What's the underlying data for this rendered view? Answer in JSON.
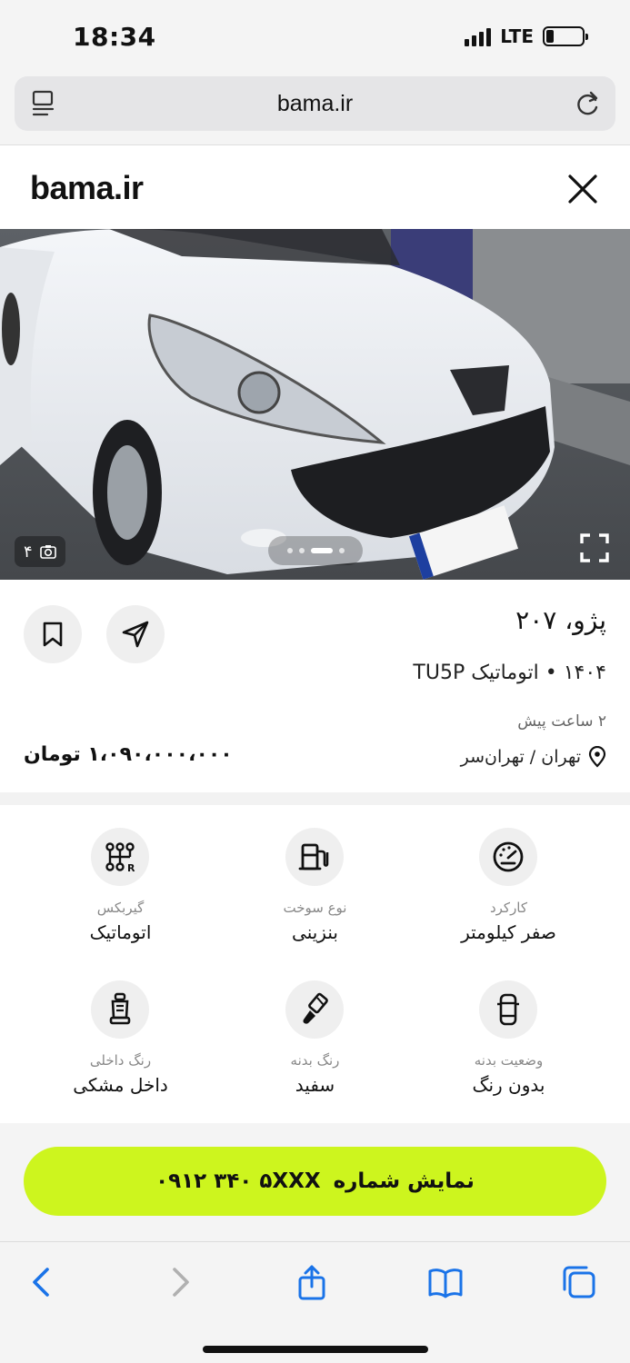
{
  "status_bar": {
    "time": "18:34",
    "network": "LTE",
    "battery_level": 0.2
  },
  "browser": {
    "url": "bama.ir"
  },
  "site": {
    "logo": "bama.ir"
  },
  "gallery": {
    "photo_count": "۴",
    "total_dots": 4,
    "active_dot": 2
  },
  "listing": {
    "title": "پژو، ۲۰۷",
    "subtitle": "۱۴۰۴ • اتوماتیک TU5P",
    "time_ago": "۲ ساعت پیش",
    "location": "تهران / تهران‌سر",
    "price": "۱،۰۹۰،۰۰۰،۰۰۰ تومان"
  },
  "specs": [
    {
      "label": "کارکرد",
      "value": "صفر کیلومتر",
      "icon": "speedometer-icon"
    },
    {
      "label": "نوع سوخت",
      "value": "بنزینی",
      "icon": "fuel-pump-icon"
    },
    {
      "label": "گیربکس",
      "value": "اتوماتیک",
      "icon": "gearbox-icon"
    },
    {
      "label": "وضعیت بدنه",
      "value": "بدون رنگ",
      "icon": "car-body-icon"
    },
    {
      "label": "رنگ بدنه",
      "value": "سفید",
      "icon": "paint-brush-icon"
    },
    {
      "label": "رنگ داخلی",
      "value": "داخل مشکی",
      "icon": "car-seat-icon"
    }
  ],
  "cta": {
    "label": "نمایش شماره",
    "phone": "۰۹۱۲ ۳۴۰ ۵XXX"
  },
  "colors": {
    "accent": "#cdf51e",
    "background_band": "#f2f2f2"
  }
}
